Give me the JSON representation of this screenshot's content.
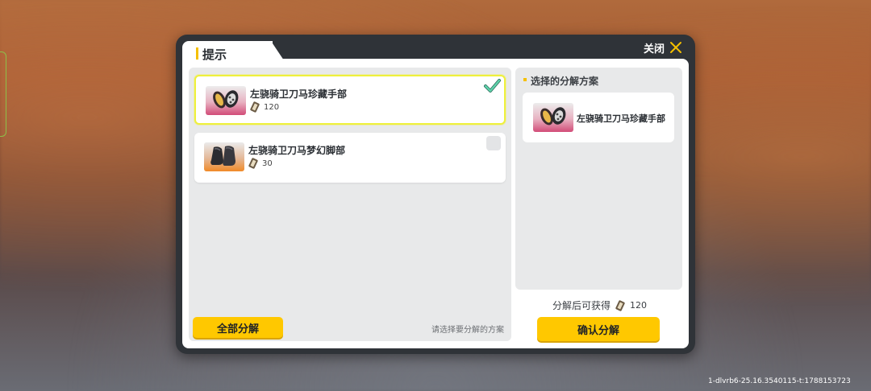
{
  "dialog": {
    "title": "提示",
    "close_label": "关闭"
  },
  "items": [
    {
      "name": "左骁骑卫刀马珍藏手部",
      "value": "120",
      "selected": true,
      "icon": "gloves-icon",
      "rarity_color": "#d24c78"
    },
    {
      "name": "左骁骑卫刀马梦幻脚部",
      "value": "30",
      "selected": false,
      "icon": "boots-icon",
      "rarity_color": "#f08a28"
    }
  ],
  "actions": {
    "decompose_all_label": "全部分解",
    "hint": "请选择要分解的方案",
    "confirm_label": "确认分解"
  },
  "selected_plan": {
    "title": "选择的分解方案",
    "item_name": "左骁骑卫刀马珍藏手部"
  },
  "obtain": {
    "label": "分解后可获得",
    "value": "120"
  },
  "build_id": "1-dlvrb6-25.16.3540115-t:1788153723",
  "colors": {
    "accent_yellow": "#ffc800",
    "selected_border": "#eef03c",
    "check_green": "#4cc89a"
  }
}
